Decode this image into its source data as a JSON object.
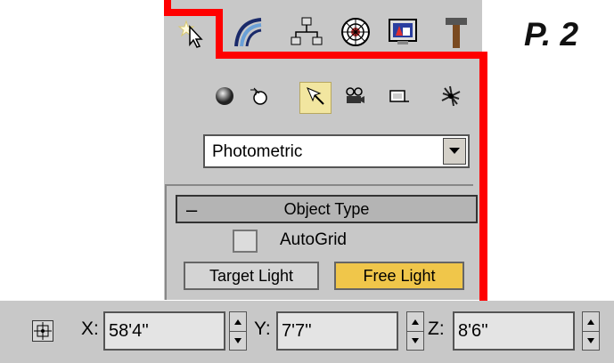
{
  "figure_label": "P. 2",
  "command_panel": {
    "tabs": [
      {
        "name": "create-tab-icon",
        "active": true
      },
      {
        "name": "modify-tab-icon"
      },
      {
        "name": "hierarchy-tab-icon"
      },
      {
        "name": "motion-tab-icon"
      },
      {
        "name": "display-tab-icon"
      },
      {
        "name": "utilities-tab-icon"
      }
    ],
    "create_categories": [
      {
        "name": "geometry-icon"
      },
      {
        "name": "shapes-icon"
      },
      {
        "name": "lights-icon",
        "active": true
      },
      {
        "name": "cameras-icon"
      },
      {
        "name": "helpers-icon"
      },
      {
        "name": "space-warps-icon"
      }
    ],
    "category_dropdown": {
      "value": "Photometric"
    },
    "object_type_rollout": {
      "collapse_symbol": "–",
      "title": "Object Type",
      "autogrid_label": "AutoGrid",
      "autogrid_checked": false,
      "buttons": {
        "target_light": "Target Light",
        "free_light": "Free Light"
      },
      "active_button": "Free Light"
    }
  },
  "coordinates_bar": {
    "x_label": "X:",
    "x_value": "58'4''",
    "y_label": "Y:",
    "y_value": "7'7''",
    "z_label": "Z:",
    "z_value": "8'6''"
  },
  "colors": {
    "highlight": "#ff0000",
    "active_button": "#f0c64a",
    "panel": "#c8c8c8"
  }
}
